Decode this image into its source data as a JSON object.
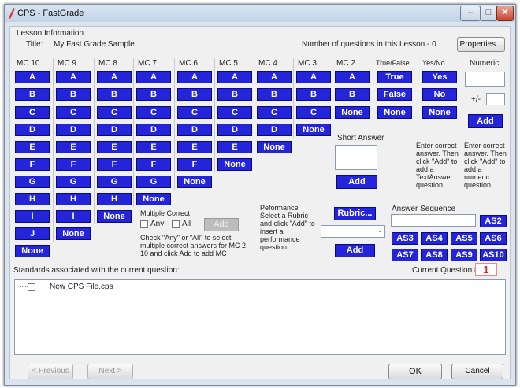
{
  "window": {
    "title": "CPS - FastGrade",
    "min": "–",
    "max": "□",
    "close": "✕"
  },
  "lesson": {
    "section": "Lesson Information",
    "title_label": "Title:",
    "title_value": "My Fast Grade Sample",
    "count_text": "Number of questions in this Lesson - 0",
    "properties": "Properties..."
  },
  "mc_headers": [
    "MC 10",
    "MC 9",
    "MC 8",
    "MC 7",
    "MC 6",
    "MC 5",
    "MC 4",
    "MC 3",
    "MC 2"
  ],
  "letters": [
    "A",
    "B",
    "C",
    "D",
    "E",
    "F",
    "G",
    "H",
    "I",
    "J"
  ],
  "none_label": "None",
  "tf": {
    "header": "True/False",
    "true": "True",
    "false": "False",
    "none": "None"
  },
  "yn": {
    "header": "Yes/No",
    "yes": "Yes",
    "no": "No",
    "none": "None"
  },
  "numeric": {
    "header": "Numeric",
    "tol": "+/-",
    "add": "Add",
    "help": "Enter correct answer. Then click \"Add\" to add a numeric question."
  },
  "short_answer": {
    "header": "Short Answer",
    "help": "Enter correct answer. Then click \"Add\" to add a TextAnswer question.",
    "add": "Add"
  },
  "multiple_correct": {
    "header": "Multiple Correct",
    "any": "Any",
    "all": "All",
    "add": "Add",
    "help": "Check \"Any\" or \"All\" to select multiple correct answers for MC 2-10 and click Add to add MC"
  },
  "performance": {
    "header": "Peformance",
    "help": "Select a Rubric and click \"Add\" to insert a performance question.",
    "rubric": "Rubric...",
    "add": "Add"
  },
  "answer_sequence": {
    "header": "Answer Sequence",
    "buttons": [
      "AS2",
      "AS3",
      "AS4",
      "AS5",
      "AS6",
      "AS7",
      "AS8",
      "AS9",
      "AS10"
    ]
  },
  "standards": {
    "label": "Standards associated with the current question:",
    "current_q_label": "Current Question #:",
    "current_q": "1",
    "tree_item": "New CPS File.cps"
  },
  "footer": {
    "previous": "< Previous",
    "next": "Next >",
    "ok": "OK",
    "cancel": "Cancel"
  },
  "colors": {
    "button_blue": "#2424d8",
    "current_q_red": "#e02020"
  }
}
